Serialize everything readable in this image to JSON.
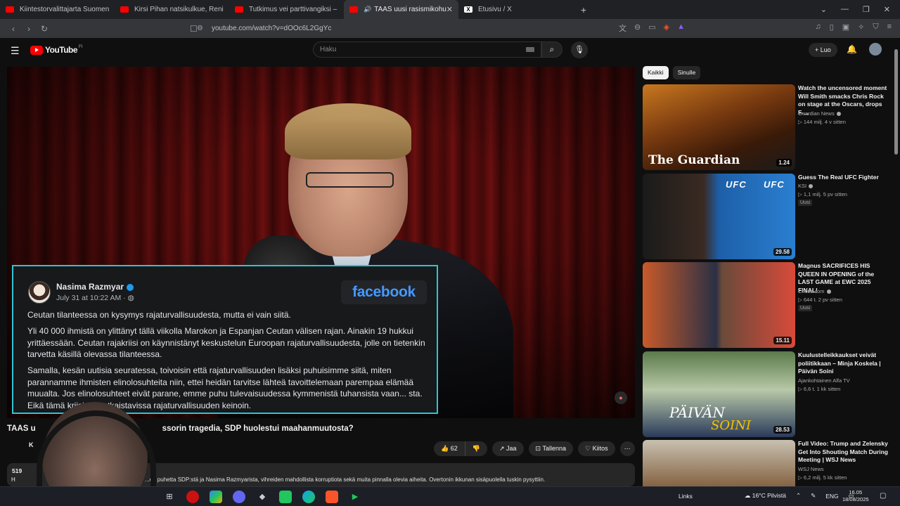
{
  "browser": {
    "tabs": [
      {
        "title": "Kiintestorvalittajarta Suomen suos...",
        "icon": "youtube-icon",
        "active": false
      },
      {
        "title": "Kirsi Pihan natsikulkue, Reni heittiti...",
        "icon": "youtube-icon",
        "active": false
      },
      {
        "title": "Tutkimus vei parttivangiksi – Atte Ka...",
        "icon": "youtube-icon",
        "active": false
      },
      {
        "title": "TAAS uusi rasismikohu, WOK...",
        "icon": "youtube-icon",
        "active": true
      },
      {
        "title": "Etusivu / X",
        "icon": "x-icon",
        "active": false
      }
    ],
    "new_tab": "+",
    "url": "youtube.com/watch?v=dOOc6L2GgYc"
  },
  "youtube": {
    "logo_text": "YouTube",
    "logo_country": "FI",
    "search_placeholder": "Haku",
    "create_label": "+ Luo"
  },
  "fbpost": {
    "author": "Nasima Razmyar",
    "date": "July 31 at 10:22 AM · ",
    "logo": "facebook",
    "p1": "Ceutan tilanteessa on kysymys rajaturvallisuudesta, mutta ei vain siitä.",
    "p2": "Yli 40 000 ihmistä on ylittänyt tällä viikolla Marokon ja Espanjan Ceutan välisen rajan. Ainakin 19 hukkui yrittäessään. Ceutan rajakriisi on käynnistänyt keskustelun Euroopan rajaturvallisuudesta, jolle on tietenkin tarvetta käsillä olevassa tilanteessa.",
    "p3": "Samalla, kesän uutisia seuratessa, toivoisin että rajaturvallisuuden lisäksi puhuisimme siitä, miten parannamme ihmisten elinolosuhteita niin, ettei heidän tarvitse lähteä tavoittelemaan parempaa elämää muualta. Jos elinolosuhteet eivät parane, emme puhu tulevaisuudessa kymmenistä tuhansista vaan... sta. Eikä tämä kriisi ole ratkaistavissa rajaturvallisuuden keinoin."
  },
  "video": {
    "title_start": "TAAS u",
    "title_end": "ssorin tragedia, SDP huolestui maahanmuutosta?",
    "channel_initial": "K",
    "likes": "62",
    "share": "Jaa",
    "save": "Tallenna",
    "thanks": "Kiitos",
    "views_short": "519",
    "desc_initial": "H",
    "description": "...en puhetta SDP:stä ja Nasima Razmyarista, vihreiden mahdollista korruptiota sekä muita pinnalla olevia aiheita. Overtonin ikkunan sisäpuolella tuskin pysyttiin."
  },
  "sidebar": {
    "chips": [
      "Kaikki",
      "Sinulle"
    ],
    "recs": [
      {
        "title": "Watch the uncensored moment Will Smith smacks Chris Rock on stage at the Oscars, drops F-...",
        "channel": "Guardian News",
        "meta": "▷ 144 milj.  4 v sitten",
        "duration": "1.24",
        "badge": "",
        "thumb_text": "The Guardian"
      },
      {
        "title": "Guess The Real UFC Fighter",
        "channel": "KSI",
        "meta": "▷ 1,1 milj.  5 pv sitten",
        "duration": "29.58",
        "badge": "Uusi",
        "thumb_text": "UFC"
      },
      {
        "title": "Magnus SACRIFICES HIS QUEEN IN OPENING of the LAST GAME at EWC 2025 FINAL!",
        "channel": "Chess.com",
        "meta": "▷ 644 t.  2 pv sitten",
        "duration": "15.11",
        "badge": "Uusi",
        "thumb_text": ""
      },
      {
        "title": "Kuulustelleikkaukset veivät poliitikkaan – Minja Koskela | Päivän Soini",
        "channel": "Ajankohtainen Alfa TV",
        "meta": "▷ 6,6 t.  1 kk sitten",
        "duration": "28.53",
        "badge": "",
        "thumb_text": "PÄIVÄN",
        "thumb_text2": "SOINI"
      },
      {
        "title": "Full Video: Trump and Zelensky Get Into Shouting Match During Meeting | WSJ News",
        "channel": "WSJ News",
        "meta": "▷ 6,2 milj.  5 kk sitten",
        "duration": "",
        "badge": "",
        "thumb_text": ""
      }
    ]
  },
  "taskbar": {
    "links": "Links",
    "weather": "16°C Pilvistä",
    "lang": "ENG",
    "time": "16.05",
    "date": "18/08/2025"
  }
}
